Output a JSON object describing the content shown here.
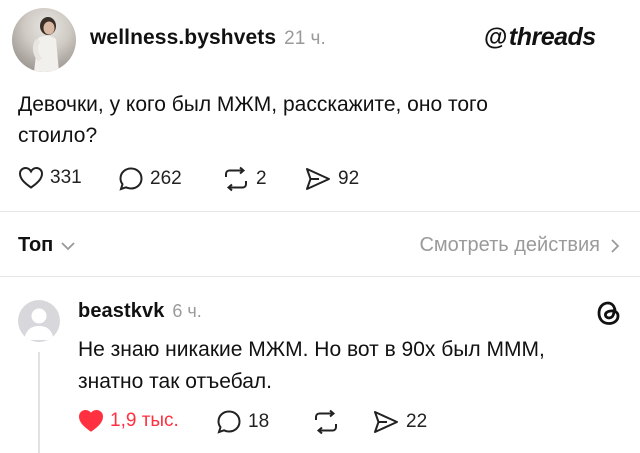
{
  "post": {
    "username": "wellness.byshvets",
    "time": "21 ч.",
    "text_line1": "Девочки, у кого был МЖМ, расскажите, оно того",
    "text_line2": "стоило?",
    "stats": {
      "likes": "331",
      "comments": "262",
      "reposts": "2",
      "shares": "92"
    }
  },
  "brand": {
    "name": "threads",
    "glyph": "@"
  },
  "sort_bar": {
    "label": "Топ",
    "view_activity": "Смотреть действия"
  },
  "reply": {
    "username": "beastkvk",
    "time": "6 ч.",
    "text_line1": "Не знаю никакие МЖМ. Но вот в 90х был МММ,",
    "text_line2": "знатно так отъебал.",
    "stats": {
      "likes": "1,9 тыс.",
      "comments": "18",
      "shares": "22"
    }
  },
  "colors": {
    "like_red": "#ff3040",
    "muted": "#9a9a9a",
    "divider": "#e6e6e6"
  },
  "icons": [
    "heart-icon",
    "comment-bubble-icon",
    "repost-icon",
    "share-icon",
    "chevron-down-icon",
    "chevron-right-icon",
    "threads-logo-icon"
  ]
}
